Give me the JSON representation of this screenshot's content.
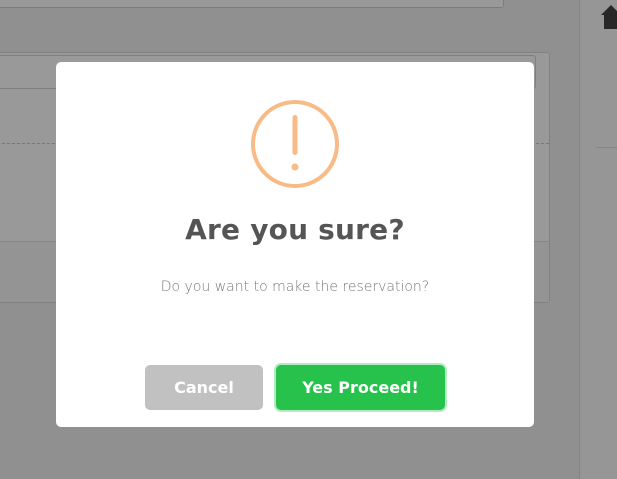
{
  "colors": {
    "warning": "#f8bb86",
    "confirm": "#27c24c",
    "cancel": "#c1c1c1",
    "title_text": "#555555",
    "body_text": "#797979"
  },
  "background": {
    "sidebar_icon": "home-icon"
  },
  "dialog": {
    "icon": "warning-icon",
    "title": "Are you sure?",
    "message": "Do you want to make the reservation?",
    "cancel_label": "Cancel",
    "confirm_label": "Yes Proceed!"
  }
}
